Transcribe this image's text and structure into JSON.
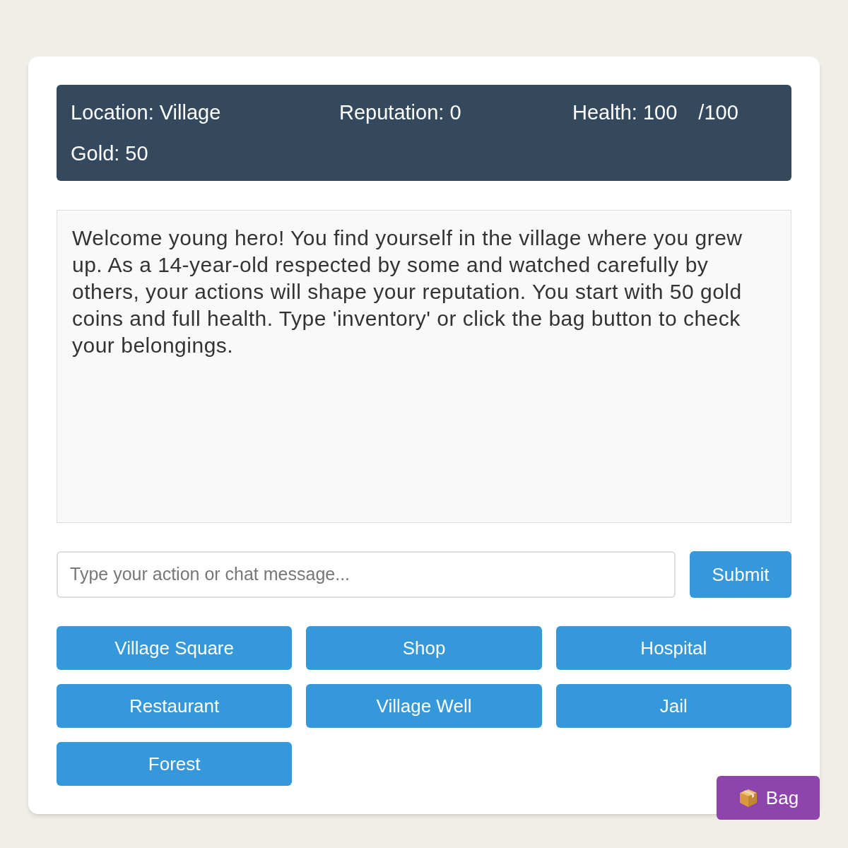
{
  "status_bar": {
    "location": "Location: Village",
    "reputation": "Reputation: 0",
    "health": "Health: 100",
    "health_max": "/100",
    "gold": "Gold: 50"
  },
  "story": "Welcome young hero! You find yourself in the village where you grew up. As a 14-year-old respected by some and watched carefully by others, your actions will shape your reputation. You start with 50 gold coins and full health. Type 'inventory' or click the bag button to check your belongings.",
  "action_input": {
    "placeholder": "Type your action or chat message..."
  },
  "submit_button": "Submit",
  "locations": [
    "Village Square",
    "Shop",
    "Hospital",
    "Restaurant",
    "Village Well",
    "Jail",
    "Forest"
  ],
  "bag_button": "Bag"
}
